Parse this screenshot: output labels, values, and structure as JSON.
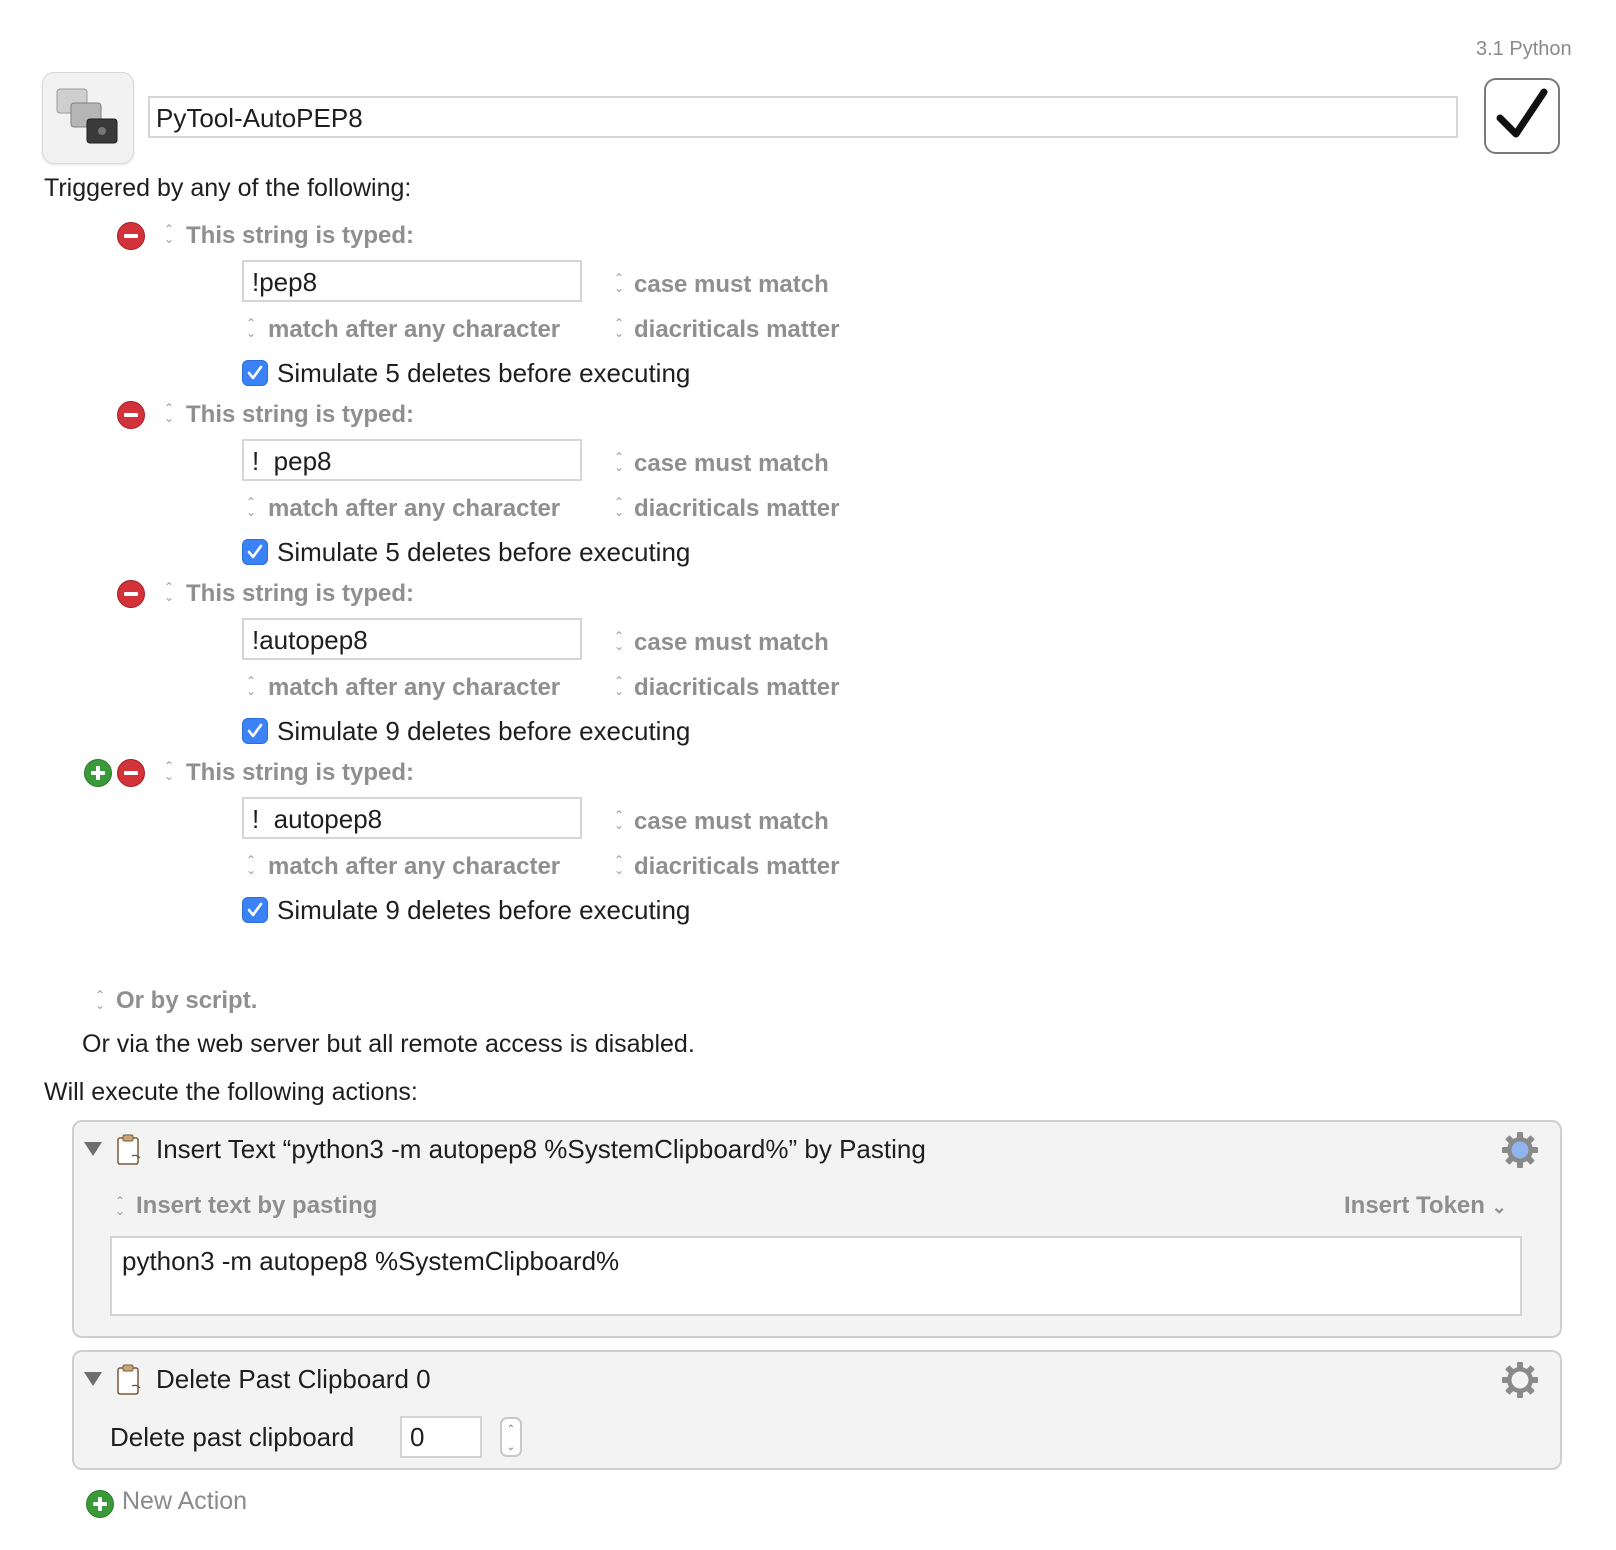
{
  "macro": {
    "group_label": "3.1 Python",
    "name": "PyTool-AutoPEP8",
    "enabled": true
  },
  "triggers_heading": "Triggered by any of the following:",
  "triggers": [
    {
      "type_label": "This string is typed:",
      "string": "!pep8",
      "case_label": "case must match",
      "match_label": "match after any character",
      "diacritics_label": "diacriticals matter",
      "simulate_label": "Simulate 5 deletes before executing",
      "simulate_checked": true
    },
    {
      "type_label": "This string is typed:",
      "string": "!  pep8",
      "case_label": "case must match",
      "match_label": "match after any character",
      "diacritics_label": "diacriticals matter",
      "simulate_label": "Simulate 5 deletes before executing",
      "simulate_checked": true
    },
    {
      "type_label": "This string is typed:",
      "string": "!autopep8",
      "case_label": "case must match",
      "match_label": "match after any character",
      "diacritics_label": "diacriticals matter",
      "simulate_label": "Simulate 9 deletes before executing",
      "simulate_checked": true
    },
    {
      "type_label": "This string is typed:",
      "string": "!  autopep8",
      "case_label": "case must match",
      "match_label": "match after any character",
      "diacritics_label": "diacriticals matter",
      "simulate_label": "Simulate 9 deletes before executing",
      "simulate_checked": true
    }
  ],
  "or_by_script": "Or by script.",
  "web_server_text": "Or via the web server but all remote access is disabled.",
  "actions_heading": "Will execute the following actions:",
  "actions": [
    {
      "title": "Insert Text “python3 -m autopep8 %SystemClipboard%” by Pasting",
      "mode_label": "Insert text by pasting",
      "insert_token_label": "Insert Token",
      "text": "python3 -m autopep8 %SystemClipboard%"
    },
    {
      "title": "Delete Past Clipboard 0",
      "field_label": "Delete past clipboard",
      "value": "0"
    }
  ],
  "new_action_label": "New Action",
  "icons": {
    "macro": "macro-group-icon",
    "remove": "remove-circle-icon",
    "add": "add-circle-icon",
    "updown": "up-down-arrows-icon",
    "disclosure": "disclosure-triangle-icon",
    "clipboard": "clipboard-icon",
    "gear": "gear-icon",
    "chevron": "chevron-down-icon",
    "check": "checkmark-icon"
  },
  "colors": {
    "remove": "#d2333a",
    "add": "#3a9a3a",
    "checkbox": "#3b82f6",
    "gear_active": "#8fb4ee"
  }
}
